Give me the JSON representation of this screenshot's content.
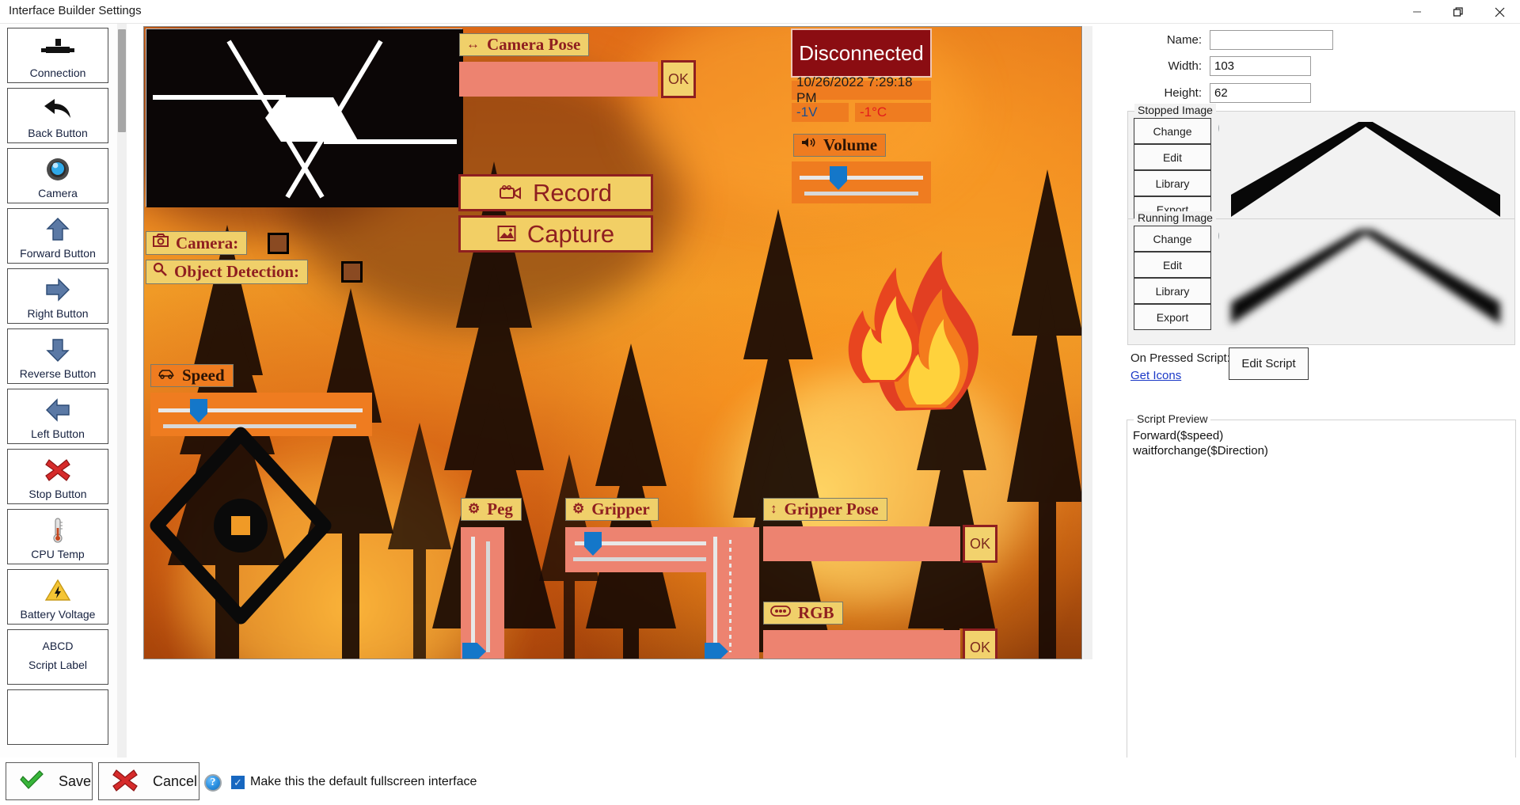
{
  "window": {
    "title": "Interface Builder Settings",
    "minimize_icon": "minimize-icon",
    "maximize_icon": "restore-icon",
    "close_icon": "close-icon"
  },
  "palette": {
    "items": [
      {
        "label": "Connection",
        "icon": "connection-icon"
      },
      {
        "label": "Back Button",
        "icon": "back-arrow-icon"
      },
      {
        "label": "Camera",
        "icon": "camera-lens-icon"
      },
      {
        "label": "Forward Button",
        "icon": "up-arrow-icon"
      },
      {
        "label": "Right Button",
        "icon": "right-arrow-icon"
      },
      {
        "label": "Reverse Button",
        "icon": "down-arrow-icon"
      },
      {
        "label": "Left Button",
        "icon": "left-arrow-icon"
      },
      {
        "label": "Stop Button",
        "icon": "red-x-icon"
      },
      {
        "label": "CPU Temp",
        "icon": "thermometer-icon"
      },
      {
        "label": "Battery Voltage",
        "icon": "warning-bolt-icon"
      }
    ],
    "script_label_item": {
      "line1": "ABCD",
      "line2": "Script Label"
    }
  },
  "canvas": {
    "camera_pose": {
      "label": "Camera Pose",
      "icon": "left-right-arrow-icon",
      "value": "",
      "ok": "OK"
    },
    "record_button": {
      "label": "Record",
      "icon": "video-camera-icon"
    },
    "capture_button": {
      "label": "Capture",
      "icon": "photo-icon"
    },
    "camera_toggle": {
      "label": "Camera:",
      "icon": "camera-icon"
    },
    "object_detection_toggle": {
      "label": "Object Detection:",
      "icon": "magnifier-icon"
    },
    "speed": {
      "label": "Speed",
      "icon": "car-icon",
      "thumb_pct": 15
    },
    "status": {
      "connection": "Disconnected",
      "timestamp": "10/26/2022 7:29:18 PM",
      "voltage": "-1V",
      "temperature": "-1°C"
    },
    "volume": {
      "label": "Volume",
      "icon": "speaker-icon",
      "thumb_pct": 32
    },
    "peg": {
      "label": "Peg",
      "icon": "gear-icon",
      "thumb_pct": 4
    },
    "gripper": {
      "label": "Gripper",
      "icon": "gear-icon",
      "thumb_pct": 14
    },
    "gripper_pose": {
      "label": "Gripper Pose",
      "icon": "up-down-arrow-icon",
      "value": "",
      "ok": "OK"
    },
    "rgb": {
      "label": "RGB",
      "icon": "rgb-icon",
      "value": "",
      "ok": "OK"
    },
    "colors": {
      "label_bg": "#f0d06a",
      "label_fg": "#8f1f20",
      "field_bg": "#ed8370",
      "button_bg": "#f2cf65",
      "status_bg": "#8b0d12",
      "badge_bg": "#ef7c20",
      "slider_thumb": "#1477c9"
    }
  },
  "properties": {
    "name": {
      "label": "Name:",
      "value": "",
      "placeholder": ""
    },
    "width": {
      "label": "Width:",
      "value": "103"
    },
    "height": {
      "label": "Height:",
      "value": "62"
    },
    "stopped_image": {
      "title": "Stopped Image",
      "buttons": [
        "Change",
        "Edit",
        "Library",
        "Export"
      ],
      "help_icon": "help-icon",
      "preview_icon": "chevron-up-sharp-icon"
    },
    "running_image": {
      "title": "Running Image",
      "buttons": [
        "Change",
        "Edit",
        "Library",
        "Export"
      ],
      "help_icon": "help-icon",
      "preview_icon": "chevron-up-blurred-icon"
    },
    "on_pressed_script_label": "On Pressed Script:",
    "get_icons_link": "Get Icons",
    "edit_script_button": "Edit Script",
    "script_preview": {
      "title": "Script Preview",
      "text": "Forward($speed)\nwaitforchange($Direction)"
    }
  },
  "bottom_bar": {
    "save": "Save",
    "cancel": "Cancel",
    "help_icon": "help-icon",
    "checkbox_label": "Make this the default fullscreen interface",
    "checkbox_checked": true
  }
}
